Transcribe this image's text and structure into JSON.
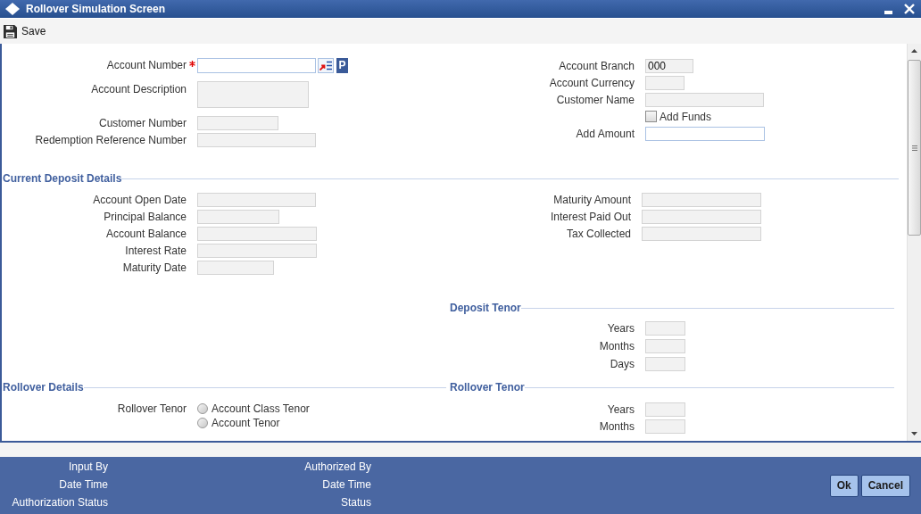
{
  "window": {
    "title": "Rollover Simulation Screen"
  },
  "toolbar": {
    "save": "Save"
  },
  "account": {
    "left": [
      {
        "kind": "lookup",
        "label": "Account Number",
        "required": true,
        "button": "P"
      },
      {
        "kind": "textarea",
        "label": "Account Description",
        "required": false
      },
      {
        "kind": "readonly",
        "label": "Customer Number",
        "required": false
      },
      {
        "kind": "readonly",
        "label": "Redemption Reference Number",
        "required": false
      }
    ],
    "right": [
      {
        "kind": "readonly",
        "label": "Account Branch",
        "value": "000"
      },
      {
        "kind": "readonly",
        "label": "Account Currency"
      },
      {
        "kind": "readonly",
        "label": "Customer Name"
      },
      {
        "kind": "checkbox",
        "label": "Add Funds",
        "checked": false
      },
      {
        "kind": "input",
        "label": "Add Amount"
      }
    ]
  },
  "current_deposit_details": {
    "title": "Current Deposit Details",
    "left": [
      "Account Open Date",
      "Principal Balance",
      "Account Balance",
      "Interest Rate",
      "Maturity Date"
    ],
    "right": [
      "Maturity Amount",
      "Interest Paid Out",
      "Tax Collected"
    ]
  },
  "deposit_tenor": {
    "title": "Deposit Tenor",
    "fields": [
      "Years",
      "Months",
      "Days"
    ]
  },
  "rollover_details": {
    "title": "Rollover Details",
    "rollover_tenor": {
      "label": "Rollover Tenor",
      "options": [
        {
          "label": "Account Class Tenor",
          "selected": false
        },
        {
          "label": "Account Tenor",
          "selected": false
        }
      ]
    }
  },
  "rollover_tenor": {
    "title": "Rollover Tenor",
    "fields": [
      "Years",
      "Months"
    ]
  },
  "footer": {
    "left": [
      "Input By",
      "Date Time",
      "Authorization Status"
    ],
    "right": [
      "Authorized By",
      "Date Time",
      "Status"
    ],
    "buttons": [
      "Ok",
      "Cancel"
    ]
  }
}
